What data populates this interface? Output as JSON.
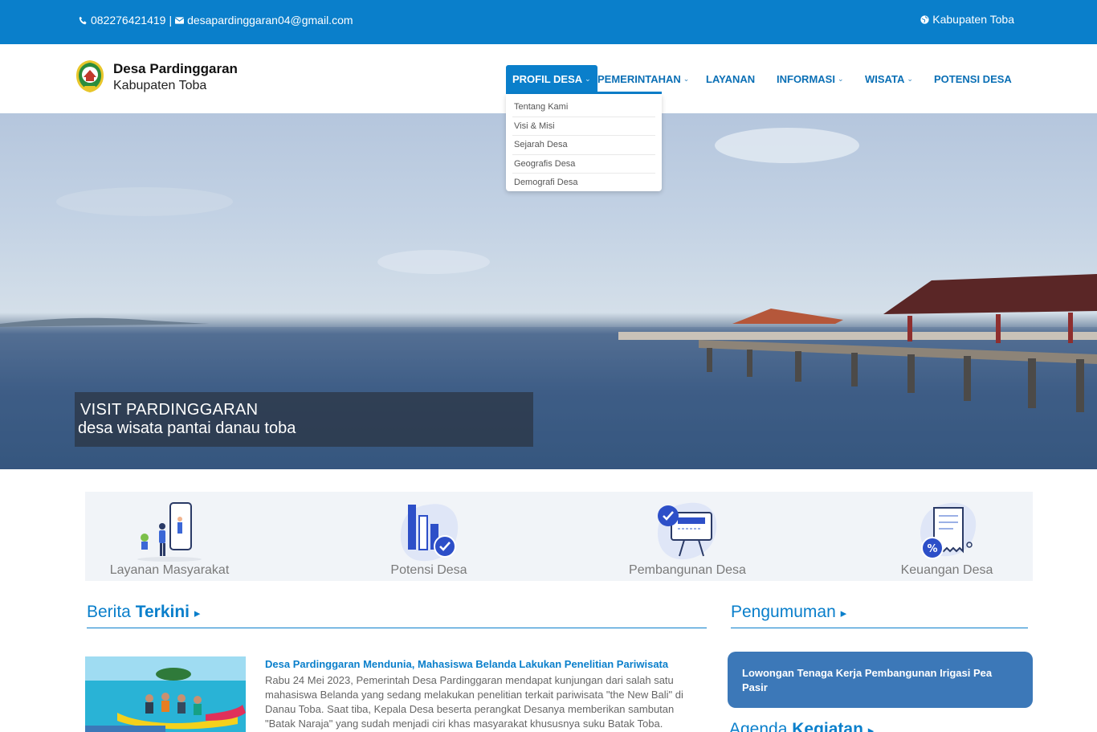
{
  "topbar": {
    "phone": "082276421419",
    "separator": "|",
    "email": "desapardinggaran04@gmail.com",
    "region": "Kabupaten Toba"
  },
  "brand": {
    "title": "Desa Pardinggaran",
    "subtitle": "Kabupaten Toba"
  },
  "nav": {
    "items": [
      {
        "label": "PROFIL DESA",
        "has_dropdown": true,
        "active": true
      },
      {
        "label": "PEMERINTAHAN",
        "has_dropdown": true
      },
      {
        "label": "LAYANAN",
        "has_dropdown": false
      },
      {
        "label": "INFORMASI",
        "has_dropdown": true
      },
      {
        "label": "WISATA",
        "has_dropdown": true
      },
      {
        "label": "POTENSI DESA",
        "has_dropdown": false
      }
    ],
    "dropdown": [
      "Tentang Kami",
      "Visi & Misi",
      "Sejarah Desa",
      "Geografis Desa",
      "Demografi Desa"
    ]
  },
  "hero": {
    "headline": "VISIT PARDINGGARAN",
    "tagline": "desa wisata pantai danau toba"
  },
  "features": [
    {
      "label": "Layanan Masyarakat",
      "icon": "people-phone-icon"
    },
    {
      "label": "Potensi Desa",
      "icon": "bar-chart-check-icon"
    },
    {
      "label": "Pembangunan Desa",
      "icon": "presentation-board-icon"
    },
    {
      "label": "Keuangan Desa",
      "icon": "receipt-percent-icon"
    }
  ],
  "news_section": {
    "title_light": "Berita",
    "title_bold": "Terkini",
    "article": {
      "title": "Desa Pardinggaran Mendunia, Mahasiswa Belanda Lakukan Penelitian Pariwisata",
      "body": "Rabu 24 Mei 2023, Pemerintah Desa Pardinggaran mendapat kunjungan dari salah satu mahasiswa Belanda yang sedang melakukan penelitian terkait pariwisata \"the New Bali\" di Danau Toba. Saat tiba, Kepala Desa beserta perangkat Desanya memberikan sambutan \"Batak Naraja\" yang sudah menjadi ciri khas masyarakat khususnya suku Batak Toba."
    }
  },
  "announcement_section": {
    "title": "Pengumuman",
    "item": "Lowongan Tenaga Kerja Pembangunan Irigasi Pea Pasir"
  },
  "agenda_section": {
    "title_light": "Agenda",
    "title_bold": "Kegiatan"
  },
  "colors": {
    "primary": "#0a7fcb",
    "announcement_bg": "#3c78b8",
    "feature_bg": "#f1f4f8"
  }
}
